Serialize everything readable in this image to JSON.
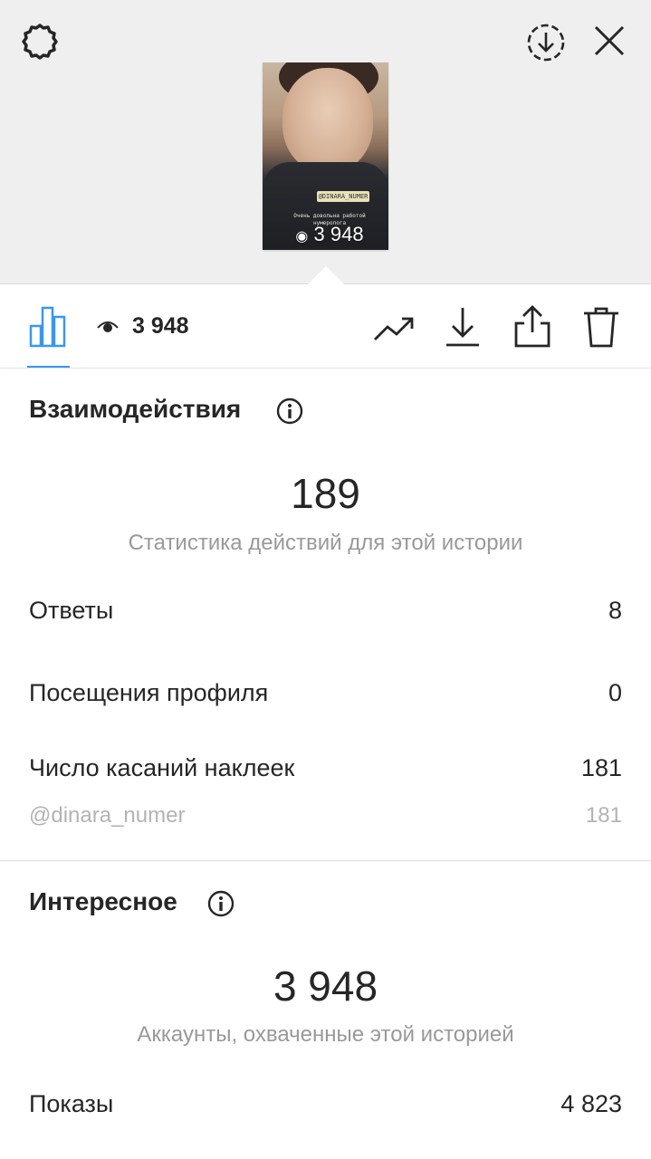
{
  "thumbnail": {
    "tag_text": "@DINARA_NUMER",
    "caption_text": "Очень довольна работой нумеролога",
    "views": "3 948"
  },
  "toolbar": {
    "views_count": "3 948"
  },
  "interactions": {
    "title": "Взаимодействия",
    "total": "189",
    "subtitle": "Статистика действий для этой истории",
    "rows": [
      {
        "label": "Ответы",
        "value": "8"
      },
      {
        "label": "Посещения профиля",
        "value": "0"
      },
      {
        "label": "Число касаний наклеек",
        "value": "181"
      }
    ],
    "sticker": {
      "label": "@dinara_numer",
      "value": "181"
    }
  },
  "discovery": {
    "title": "Интересное",
    "total": "3 948",
    "subtitle": "Аккаунты, охваченные этой историей",
    "rows": [
      {
        "label": "Показы",
        "value": "4 823"
      }
    ]
  },
  "colors": {
    "accent": "#3897f0",
    "text": "#262626",
    "muted": "#999999",
    "top_background": "#efefef"
  },
  "icons": [
    "settings-icon",
    "download-circle-icon",
    "close-icon",
    "bar-chart-icon",
    "eye-icon",
    "trend-icon",
    "download-icon",
    "share-icon",
    "trash-icon",
    "info-icon"
  ]
}
